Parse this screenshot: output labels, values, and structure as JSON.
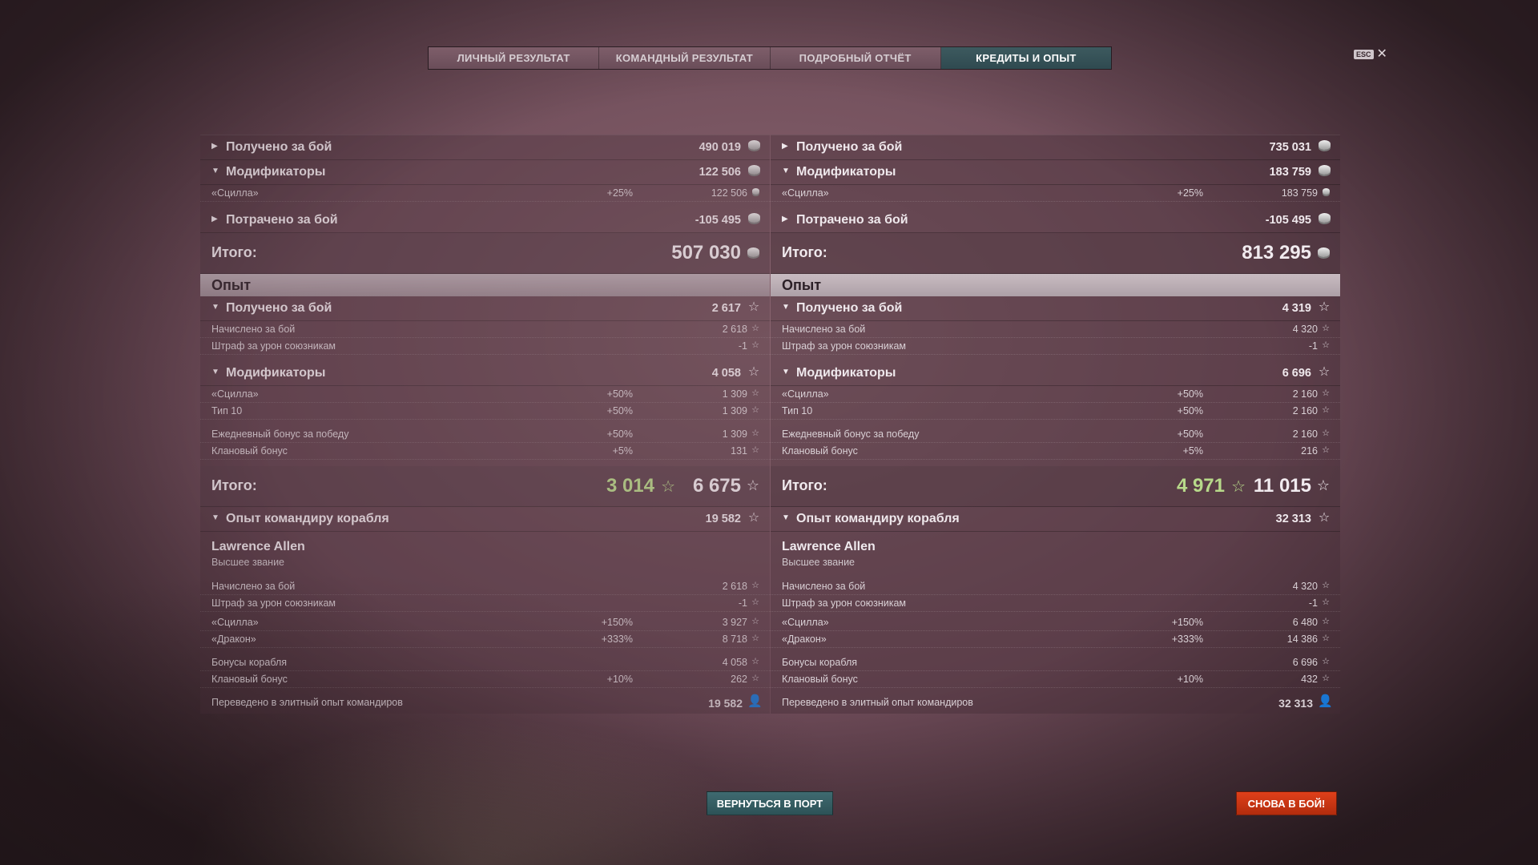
{
  "tabs": [
    {
      "label": "ЛИЧНЫЙ РЕЗУЛЬТАТ"
    },
    {
      "label": "КОМАНДНЫЙ РЕЗУЛЬТАТ"
    },
    {
      "label": "ПОДРОБНЫЙ ОТЧЁТ"
    },
    {
      "label": "КРЕДИТЫ И ОПЫТ"
    }
  ],
  "esc": {
    "key": "ESC",
    "close": "✕"
  },
  "left": {
    "credits": {
      "earned": {
        "label": "Получено за бой",
        "value": "490 019"
      },
      "modifiers": {
        "label": "Модификаторы",
        "value": "122 506"
      },
      "scylla": {
        "label": "«Сцилла»",
        "pct": "+25%",
        "value": "122 506"
      },
      "spent": {
        "label": "Потрачено за бой",
        "value": "-105 495"
      },
      "total": {
        "label": "Итого:",
        "value": "507 030"
      }
    },
    "xp": {
      "band": "Опыт",
      "earned": {
        "label": "Получено за бой",
        "value": "2 617"
      },
      "accrued": {
        "label": "Начислено за бой",
        "value": "2 618"
      },
      "penalty": {
        "label": "Штраф за урон союзникам",
        "value": "-1"
      },
      "modifiers": {
        "label": "Модификаторы",
        "value": "4 058"
      },
      "scylla": {
        "label": "«Сцилла»",
        "pct": "+50%",
        "value": "1 309"
      },
      "type10": {
        "label": "Тип 10",
        "pct": "+50%",
        "value": "1 309"
      },
      "daily": {
        "label": "Ежедневный бонус за победу",
        "pct": "+50%",
        "value": "1 309"
      },
      "clan": {
        "label": "Клановый бонус",
        "pct": "+5%",
        "value": "131"
      },
      "total": {
        "label": "Итого:",
        "free": "3 014",
        "value": "6 675"
      }
    },
    "commander": {
      "header": {
        "label": "Опыт командиру корабля",
        "value": "19 582"
      },
      "name": "Lawrence Allen",
      "rank": "Высшее звание",
      "accrued": {
        "label": "Начислено за бой",
        "value": "2 618"
      },
      "penalty": {
        "label": "Штраф за урон союзникам",
        "value": "-1"
      },
      "scylla": {
        "label": "«Сцилла»",
        "pct": "+150%",
        "value": "3 927"
      },
      "dragon": {
        "label": "«Дракон»",
        "pct": "+333%",
        "value": "8 718"
      },
      "ship": {
        "label": "Бонусы корабля",
        "value": "4 058"
      },
      "clan": {
        "label": "Клановый бонус",
        "pct": "+10%",
        "value": "262"
      },
      "elite": {
        "label": "Переведено в элитный опыт командиров",
        "value": "19 582"
      }
    }
  },
  "right": {
    "credits": {
      "earned": {
        "label": "Получено за бой",
        "value": "735 031"
      },
      "modifiers": {
        "label": "Модификаторы",
        "value": "183 759"
      },
      "scylla": {
        "label": "«Сцилла»",
        "pct": "+25%",
        "value": "183 759"
      },
      "spent": {
        "label": "Потрачено за бой",
        "value": "-105 495"
      },
      "total": {
        "label": "Итого:",
        "value": "813 295"
      }
    },
    "xp": {
      "band": "Опыт",
      "earned": {
        "label": "Получено за бой",
        "value": "4 319"
      },
      "accrued": {
        "label": "Начислено за бой",
        "value": "4 320"
      },
      "penalty": {
        "label": "Штраф за урон союзникам",
        "value": "-1"
      },
      "modifiers": {
        "label": "Модификаторы",
        "value": "6 696"
      },
      "scylla": {
        "label": "«Сцилла»",
        "pct": "+50%",
        "value": "2 160"
      },
      "type10": {
        "label": "Тип 10",
        "pct": "+50%",
        "value": "2 160"
      },
      "daily": {
        "label": "Ежедневный бонус за победу",
        "pct": "+50%",
        "value": "2 160"
      },
      "clan": {
        "label": "Клановый бонус",
        "pct": "+5%",
        "value": "216"
      },
      "total": {
        "label": "Итого:",
        "free": "4 971",
        "value": "11 015"
      }
    },
    "commander": {
      "header": {
        "label": "Опыт командиру корабля",
        "value": "32 313"
      },
      "name": "Lawrence Allen",
      "rank": "Высшее звание",
      "accrued": {
        "label": "Начислено за бой",
        "value": "4 320"
      },
      "penalty": {
        "label": "Штраф за урон союзникам",
        "value": "-1"
      },
      "scylla": {
        "label": "«Сцилла»",
        "pct": "+150%",
        "value": "6 480"
      },
      "dragon": {
        "label": "«Дракон»",
        "pct": "+333%",
        "value": "14 386"
      },
      "ship": {
        "label": "Бонусы корабля",
        "value": "6 696"
      },
      "clan": {
        "label": "Клановый бонус",
        "pct": "+10%",
        "value": "432"
      },
      "elite": {
        "label": "Переведено в элитный опыт командиров",
        "value": "32 313"
      }
    }
  },
  "icons": {
    "collapsed": "▶",
    "expanded": "▼",
    "star": "☆",
    "coin": "credits-coin-icon"
  },
  "buttons": {
    "port": "ВЕРНУТЬСЯ В ПОРТ",
    "battle": "СНОВА В БОЙ!"
  },
  "colors": {
    "active_tab": "#2f4a50",
    "free_xp": "#b7d98a",
    "battle_button": "#c8340f",
    "port_button": "#34595e"
  }
}
